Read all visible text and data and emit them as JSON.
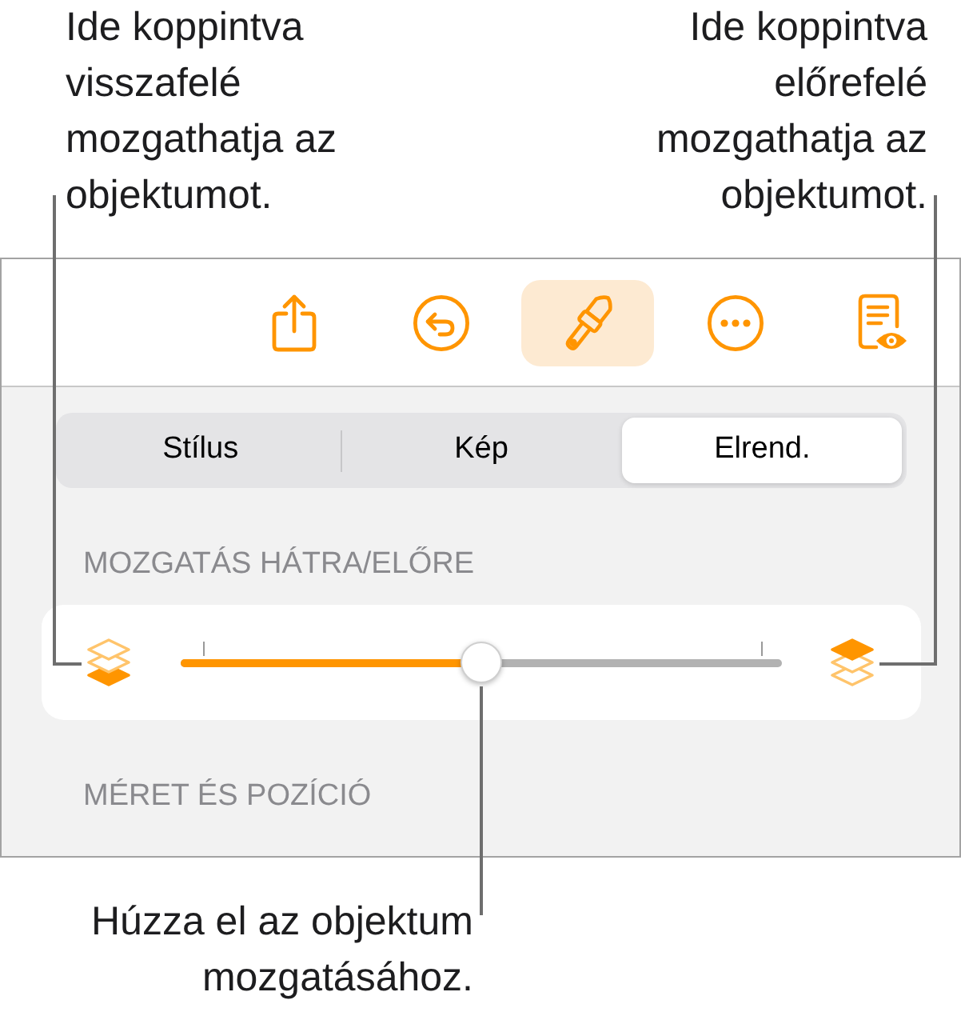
{
  "callouts": {
    "send_backward": "Ide koppintva visszafelé mozgathatja az objektumot.",
    "bring_forward": "Ide koppintva előrefelé mozgathatja az objektumot.",
    "slider": "Húzza el az objektum mozgatásához."
  },
  "toolbar": [
    {
      "kind": "share",
      "selected": false
    },
    {
      "kind": "undo",
      "selected": false
    },
    {
      "kind": "format",
      "selected": true
    },
    {
      "kind": "more",
      "selected": false
    },
    {
      "kind": "reader",
      "selected": false
    }
  ],
  "tabs": [
    {
      "label": "Stílus",
      "selected": false
    },
    {
      "label": "Kép",
      "selected": false
    },
    {
      "label": "Elrend.",
      "selected": true
    }
  ],
  "sections": [
    {
      "title": "MOZGATÁS HÁTRA/ELŐRE",
      "slider": {
        "level": 0.5
      }
    },
    {
      "title": "MÉRET ÉS POZÍCIÓ"
    }
  ]
}
